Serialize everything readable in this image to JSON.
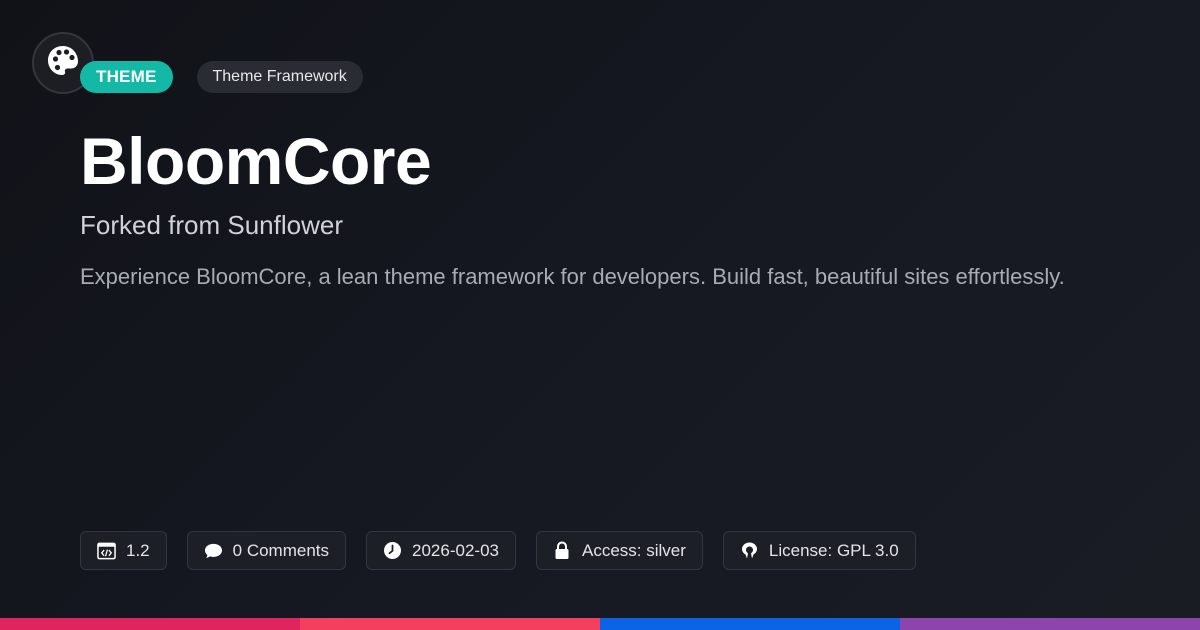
{
  "badge": {
    "type_label": "THEME",
    "category_label": "Theme Framework"
  },
  "title": "BloomCore",
  "subtitle": "Forked from Sunflower",
  "description": "Experience BloomCore, a lean theme framework for developers. Build fast, beautiful sites effortlessly.",
  "meta": {
    "version": "1.2",
    "comments": "0 Comments",
    "date": "2026-02-03",
    "access": "Access: silver",
    "license": "License: GPL 3.0"
  },
  "icons": {
    "logo": "palette-icon",
    "version": "code-window-icon",
    "comments": "speech-bubble-icon",
    "date": "clock-icon",
    "access": "lock-icon",
    "license": "open-source-icon"
  },
  "colors": {
    "accent": "#14b8a6",
    "stripe": [
      "#e0245e",
      "#f43f5e",
      "#0b63e5",
      "#8e44ad"
    ]
  }
}
